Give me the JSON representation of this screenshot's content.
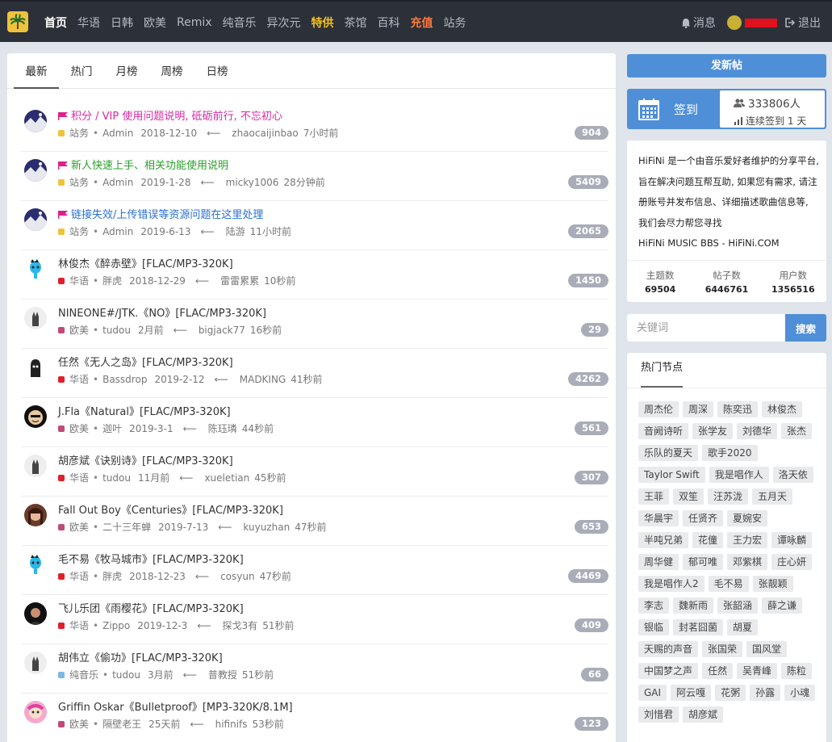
{
  "nav": {
    "items": [
      {
        "label": "首页",
        "style": "active"
      },
      {
        "label": "华语",
        "style": ""
      },
      {
        "label": "日韩",
        "style": ""
      },
      {
        "label": "欧美",
        "style": ""
      },
      {
        "label": "Remix",
        "style": ""
      },
      {
        "label": "纯音乐",
        "style": ""
      },
      {
        "label": "异次元",
        "style": ""
      },
      {
        "label": "特供",
        "style": "yellow"
      },
      {
        "label": "茶馆",
        "style": ""
      },
      {
        "label": "百科",
        "style": ""
      },
      {
        "label": "充值",
        "style": "orange"
      },
      {
        "label": "站务",
        "style": ""
      }
    ],
    "messages_label": "消息",
    "logout_label": "退出"
  },
  "tabs": [
    "最新",
    "热门",
    "月榜",
    "周榜",
    "日榜"
  ],
  "threads": [
    {
      "title": "积分 / VIP 使用问题说明, 砥砺前行, 不忘初心",
      "pinned": true,
      "title_color": "pink",
      "forum": "站务",
      "dot": "#f0c23b",
      "author": "Admin",
      "date": "2018-12-10",
      "last_user": "zhaocaijinbao",
      "last_time": "7小时前",
      "count": "904",
      "avatar": "galaxy"
    },
    {
      "title": "新人快速上手、相关功能使用说明",
      "pinned": true,
      "title_color": "green",
      "forum": "站务",
      "dot": "#f0c23b",
      "author": "Admin",
      "date": "2019-1-28",
      "last_user": "micky1006",
      "last_time": "28分钟前",
      "count": "5409",
      "avatar": "galaxy"
    },
    {
      "title": "链接失效/上传错误等资源问题在这里处理",
      "pinned": true,
      "title_color": "blue",
      "forum": "站务",
      "dot": "#f0c23b",
      "author": "Admin",
      "date": "2019-6-13",
      "last_user": "陆游",
      "last_time": "11小时前",
      "count": "2065",
      "avatar": "galaxy"
    },
    {
      "title": "林俊杰《醉赤壁》[FLAC/MP3-320K]",
      "pinned": false,
      "title_color": "",
      "forum": "华语",
      "dot": "#e0202a",
      "author": "胖虎",
      "date": "2018-12-29",
      "last_user": "雷雷累累",
      "last_time": "10秒前",
      "count": "1450",
      "avatar": "alien"
    },
    {
      "title": "NINEONE#/JTK.《NO》[FLAC/MP3-320K]",
      "pinned": false,
      "title_color": "",
      "forum": "欧美",
      "dot": "#c04a7a",
      "author": "tudou",
      "date": "2月前",
      "last_user": "bigjack77",
      "last_time": "16秒前",
      "count": "29",
      "avatar": "hand"
    },
    {
      "title": "任然《无人之岛》[FLAC/MP3-320K]",
      "pinned": false,
      "title_color": "",
      "forum": "华语",
      "dot": "#e0202a",
      "author": "Bassdrop",
      "date": "2019-2-12",
      "last_user": "MADKING",
      "last_time": "41秒前",
      "count": "4262",
      "avatar": "ghost"
    },
    {
      "title": "J.Fla《Natural》[FLAC/MP3-320K]",
      "pinned": false,
      "title_color": "",
      "forum": "欧美",
      "dot": "#c04a7a",
      "author": "迦叶",
      "date": "2019-3-1",
      "last_user": "陈珏璘",
      "last_time": "44秒前",
      "count": "561",
      "avatar": "face"
    },
    {
      "title": "胡彦斌《诀别诗》[FLAC/MP3-320K]",
      "pinned": false,
      "title_color": "",
      "forum": "华语",
      "dot": "#e0202a",
      "author": "tudou",
      "date": "11月前",
      "last_user": "xueletian",
      "last_time": "45秒前",
      "count": "307",
      "avatar": "hand"
    },
    {
      "title": "Fall Out Boy《Centuries》[FLAC/MP3-320K]",
      "pinned": false,
      "title_color": "",
      "forum": "欧美",
      "dot": "#c04a7a",
      "author": "二十三年蝉",
      "date": "2019-7-13",
      "last_user": "kuyuzhan",
      "last_time": "47秒前",
      "count": "653",
      "avatar": "girl"
    },
    {
      "title": "毛不易《牧马城市》[FLAC/MP3-320K]",
      "pinned": false,
      "title_color": "",
      "forum": "华语",
      "dot": "#e0202a",
      "author": "胖虎",
      "date": "2018-12-23",
      "last_user": "cosyun",
      "last_time": "47秒前",
      "count": "4469",
      "avatar": "alien"
    },
    {
      "title": "飞儿乐团《雨樱花》[FLAC/MP3-320K]",
      "pinned": false,
      "title_color": "",
      "forum": "华语",
      "dot": "#e0202a",
      "author": "Zippo",
      "date": "2019-12-3",
      "last_user": "探戈3有",
      "last_time": "51秒前",
      "count": "409",
      "avatar": "dark"
    },
    {
      "title": "胡伟立《偷功》[FLAC/MP3-320K]",
      "pinned": false,
      "title_color": "",
      "forum": "纯音乐",
      "dot": "#7cb8e8",
      "author": "tudou",
      "date": "3月前",
      "last_user": "普教授",
      "last_time": "51秒前",
      "count": "66",
      "avatar": "hand"
    },
    {
      "title": "Griffin Oskar《Bulletproof》[MP3-320K/8.1M]",
      "pinned": false,
      "title_color": "",
      "forum": "欧美",
      "dot": "#c04a7a",
      "author": "隔壁老王",
      "date": "25天前",
      "last_user": "hifinifs",
      "last_time": "53秒前",
      "count": "123",
      "avatar": "cartoon"
    }
  ],
  "sidebar": {
    "post_button": "发新帖",
    "signin_label": "签到",
    "signin_people": "333806人",
    "signin_streak": "连续签到 1 天",
    "about_text": "HiFiNi 是一个由音乐爱好者维护的分享平台, 旨在解决问题互帮互助, 如果您有需求, 请注册账号并发布信息、详细描述歌曲信息等, 我们会尽力帮您寻找",
    "about_site": "HiFiNi MUSIC BBS - HiFiNi.COM",
    "stats": [
      {
        "label": "主题数",
        "value": "69504"
      },
      {
        "label": "帖子数",
        "value": "6446761"
      },
      {
        "label": "用户数",
        "value": "1356516"
      }
    ],
    "search_placeholder": "关键词",
    "search_button": "搜索",
    "hot_title": "热门节点",
    "tags": [
      "周杰伦",
      "周深",
      "陈奕迅",
      "林俊杰",
      "音阙诗听",
      "张学友",
      "刘德华",
      "张杰",
      "乐队的夏天",
      "歌手2020",
      "Taylor Swift",
      "我是唱作人",
      "洛天依",
      "王菲",
      "双笙",
      "汪苏泷",
      "五月天",
      "华晨宇",
      "任贤齐",
      "夏婉安",
      "半吨兄弟",
      "花僮",
      "王力宏",
      "谭咏麟",
      "周华健",
      "郁可唯",
      "邓紫棋",
      "庄心妍",
      "我是唱作人2",
      "毛不易",
      "张靓颖",
      "李志",
      "魏新雨",
      "张韶涵",
      "薛之谦",
      "银临",
      "封茗囧菌",
      "胡夏",
      "天赐的声音",
      "张国荣",
      "国风堂",
      "中国梦之声",
      "任然",
      "吴青峰",
      "陈粒",
      "GAI",
      "阿云嘎",
      "花粥",
      "孙露",
      "小魂",
      "刘惜君",
      "胡彦斌"
    ]
  }
}
